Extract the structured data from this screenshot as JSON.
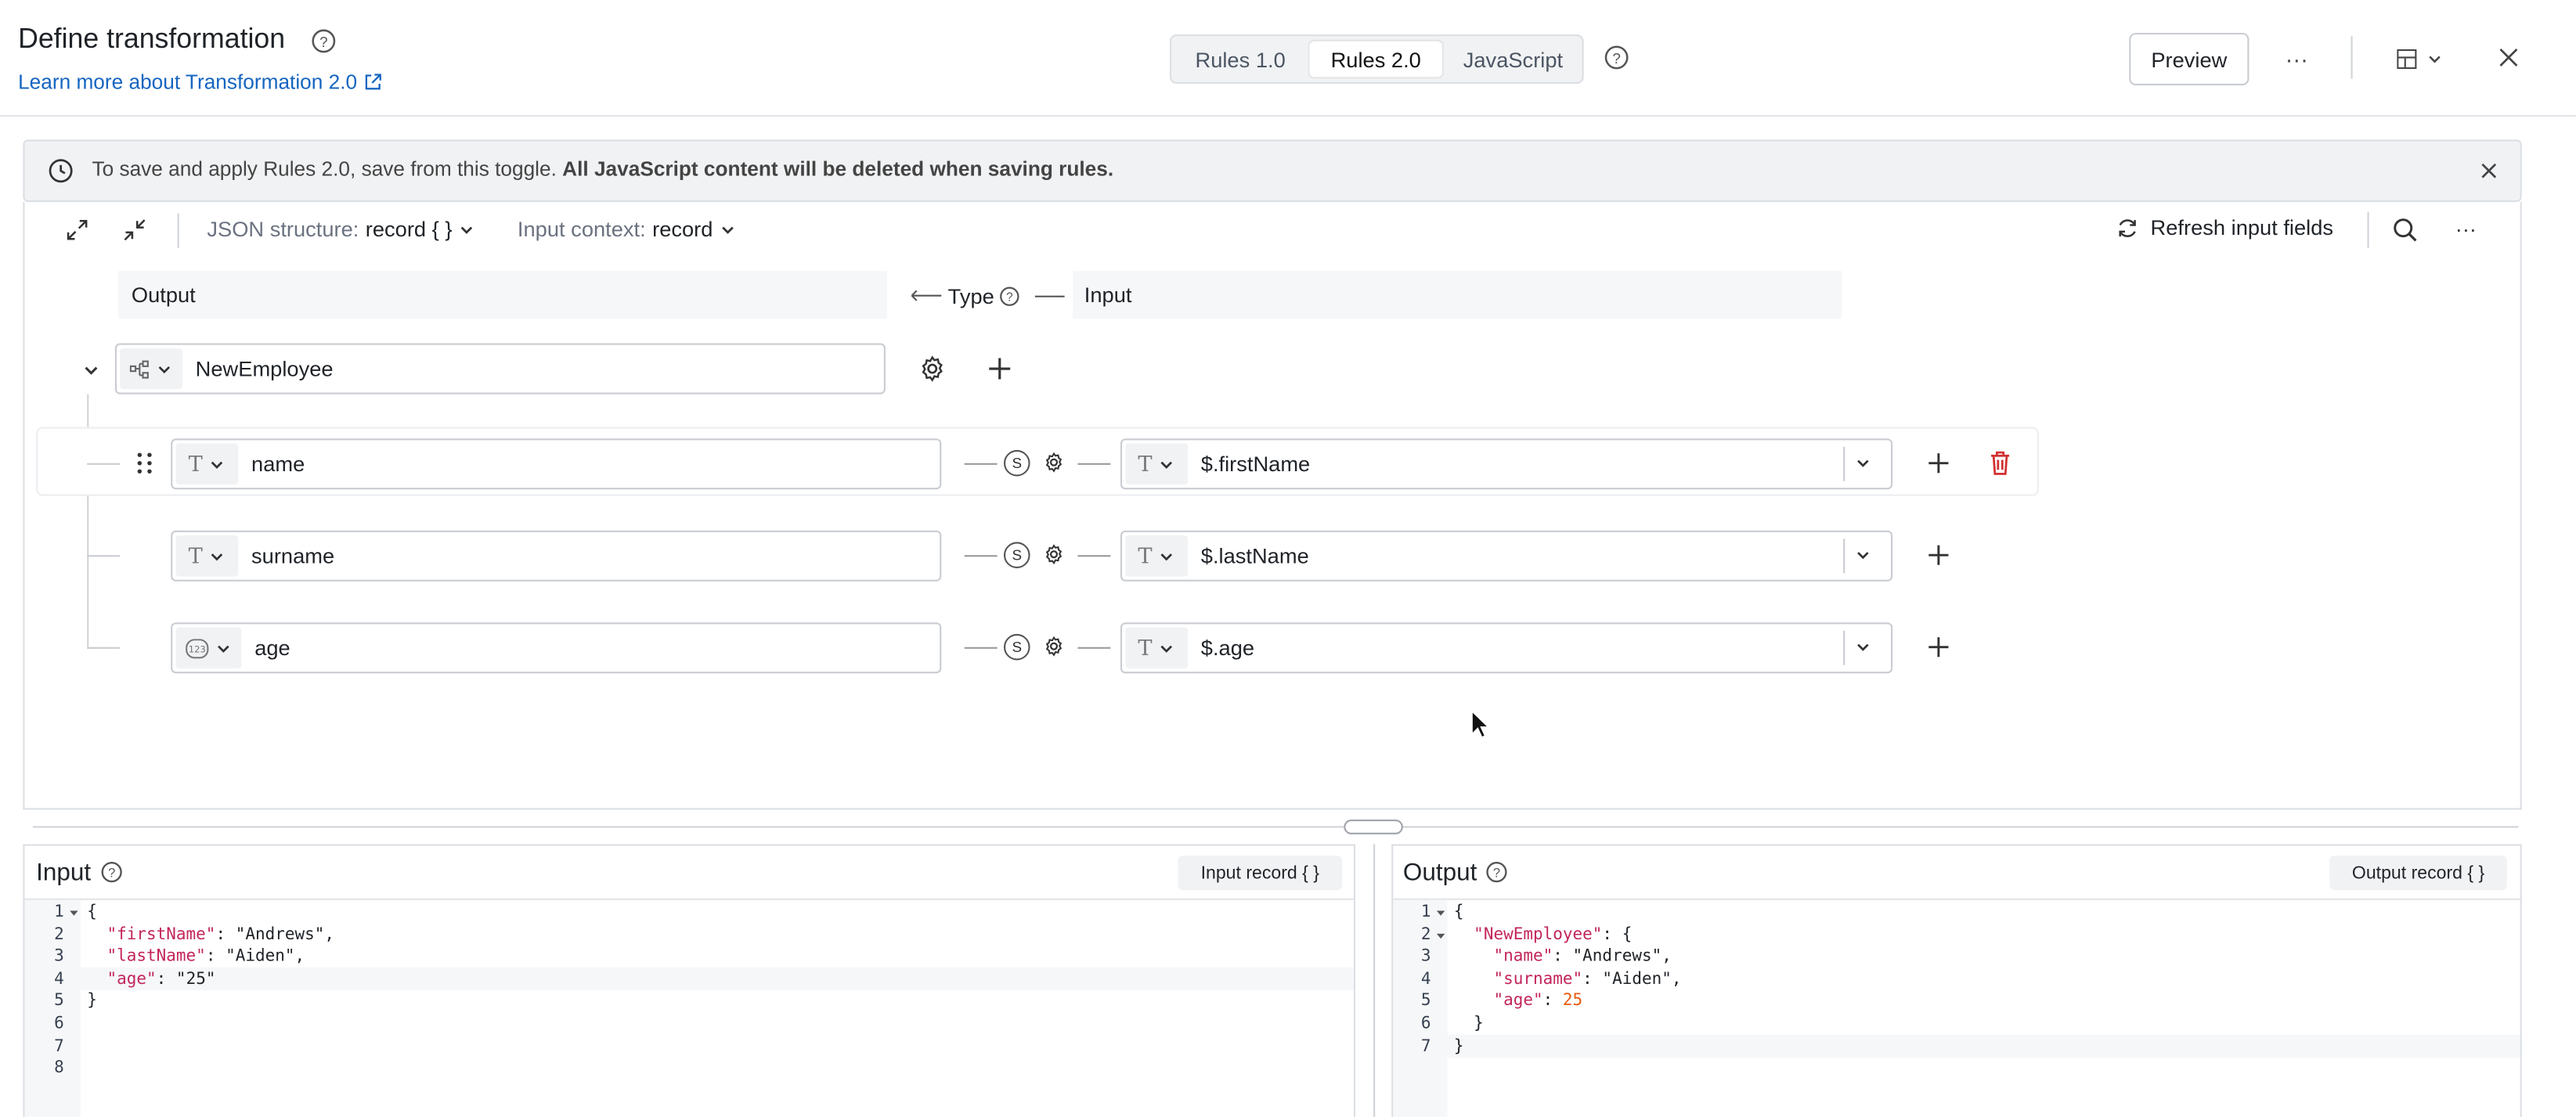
{
  "header": {
    "title": "Define transformation",
    "learn_link": "Learn more about Transformation 2.0",
    "tabs": [
      {
        "label": "Rules 1.0",
        "active": false
      },
      {
        "label": "Rules 2.0",
        "active": true
      },
      {
        "label": "JavaScript",
        "active": false
      }
    ],
    "preview_label": "Preview",
    "more_label": "···"
  },
  "banner": {
    "text": "To save and apply Rules 2.0, save from this toggle.",
    "bold_text": "All JavaScript content will be deleted when saving rules."
  },
  "toolbar": {
    "json_structure_label": "JSON structure:",
    "json_structure_value": "record { }",
    "input_context_label": "Input context:",
    "input_context_value": "record",
    "refresh_label": "Refresh input fields"
  },
  "mapping": {
    "output_header": "Output",
    "type_header": "Type",
    "input_header": "Input",
    "root_name": "NewEmployee",
    "rows": [
      {
        "output": "name",
        "type_icon": "text-type-icon",
        "input": "$.firstName",
        "has_delete": true
      },
      {
        "output": "surname",
        "type_icon": "text-type-icon",
        "input": "$.lastName",
        "has_delete": false
      },
      {
        "output": "age",
        "type_icon": "number-type-icon",
        "input": "$.age",
        "has_delete": false
      }
    ],
    "type_glyph": "T",
    "s_glyph": "S"
  },
  "input_panel": {
    "title": "Input",
    "record_button": "Input record { }",
    "line_numbers": [
      "1",
      "2",
      "3",
      "4",
      "5",
      "6",
      "7",
      "8"
    ],
    "lines": [
      "{",
      "  \"firstName\": \"Andrews\",",
      "  \"lastName\": \"Aiden\",",
      "  \"age\": \"25\"",
      "}",
      "",
      "",
      ""
    ]
  },
  "output_panel": {
    "title": "Output",
    "record_button": "Output record { }",
    "line_numbers": [
      "1",
      "2",
      "3",
      "4",
      "5",
      "6",
      "7"
    ],
    "lines": [
      "{",
      "  \"NewEmployee\": {",
      "    \"name\": \"Andrews\",",
      "    \"surname\": \"Aiden\",",
      "    \"age\": 25",
      "  }",
      "}"
    ]
  },
  "colors": {
    "accent_blue": "#1565c0",
    "delete_red": "#d32f2f",
    "banner_bg": "#f1f2f4",
    "key_color": "#c2255c",
    "number_color": "#e8590c"
  }
}
